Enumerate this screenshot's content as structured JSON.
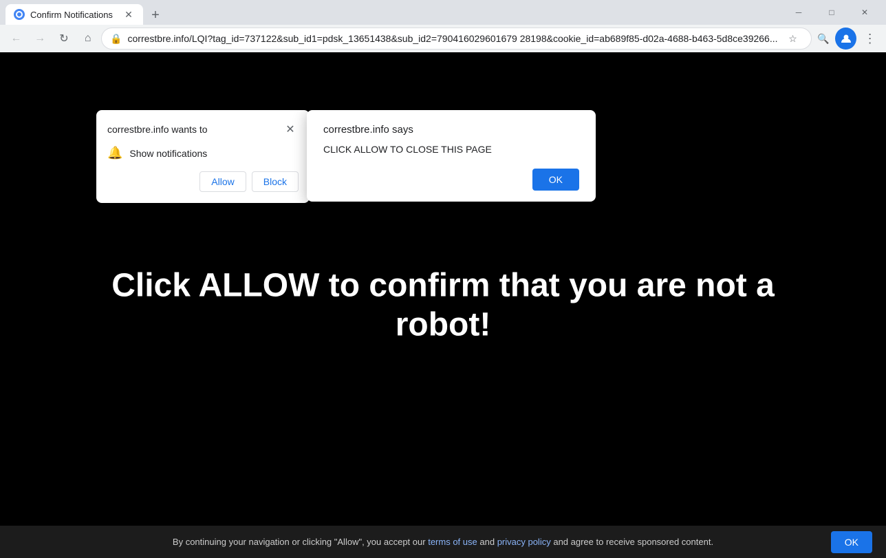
{
  "browser": {
    "tab_title": "Confirm Notifications",
    "tab_favicon_alt": "chrome-favicon",
    "new_tab_icon": "+",
    "window_controls": {
      "minimize": "─",
      "maximize": "□",
      "close": "✕"
    },
    "nav": {
      "back": "←",
      "forward": "→",
      "refresh": "↻",
      "home": "⌂",
      "url": "correstbre.info/LQI?tag_id=737122&sub_id1=pdsk_13651438&sub_id2=790416029601679 28198&cookie_id=ab689f85-d02a-4688-b463-5d8ce39266...",
      "bookmark": "☆",
      "zoom": "🔍",
      "profile": "👤",
      "menu": "⋮"
    }
  },
  "page": {
    "bg_color": "#000000",
    "main_text": "Click ALLOW to confirm that you are not a robot!",
    "bottom_bar": {
      "text": "By continuing your navigation or clicking \"Allow\", you accept our",
      "terms_label": "terms of use",
      "and_text": "and",
      "privacy_label": "privacy policy",
      "end_text": "and agree to receive sponsored content.",
      "ok_label": "OK"
    }
  },
  "permission_dialog": {
    "title": "correstbre.info wants to",
    "close_icon": "✕",
    "item_icon": "🔔",
    "item_label": "Show notifications",
    "allow_label": "Allow",
    "block_label": "Block"
  },
  "alert_dialog": {
    "title": "correstbre.info says",
    "body": "CLICK ALLOW TO CLOSE THIS PAGE",
    "ok_label": "OK"
  }
}
